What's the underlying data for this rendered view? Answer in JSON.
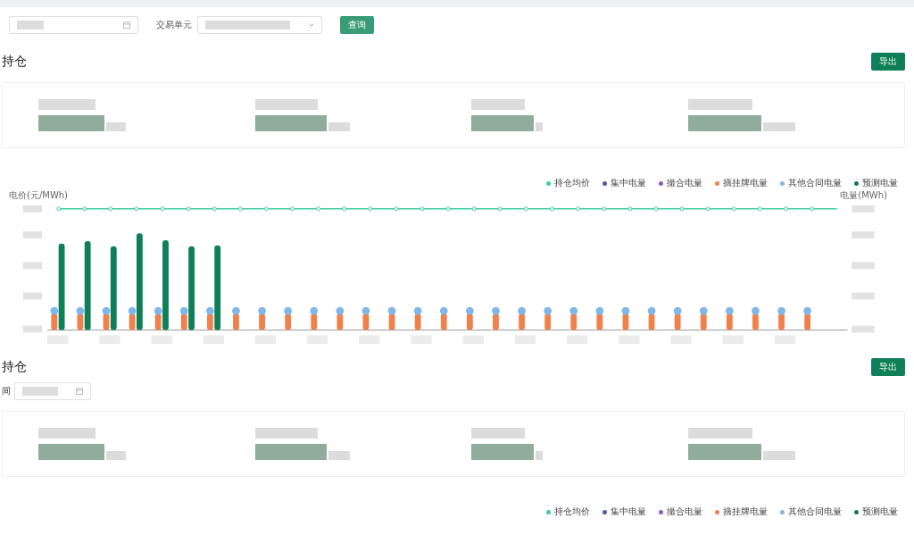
{
  "filters": {
    "trade_unit_label": "交易单元",
    "query_button": "查询"
  },
  "sections": [
    {
      "title": "持仓",
      "export_button": "导出",
      "chart": {
        "y_left_label": "电价(元/MWh)",
        "y_right_label": "电量(MWh)",
        "legend": [
          {
            "name": "持仓均价",
            "color": "#3fcf9f"
          },
          {
            "name": "集中电量",
            "color": "#4a5aa8"
          },
          {
            "name": "撮合电量",
            "color": "#8a5cc7"
          },
          {
            "name": "摘挂牌电量",
            "color": "#f0814a"
          },
          {
            "name": "其他合同电量",
            "color": "#7fb7e6"
          },
          {
            "name": "预测电量",
            "color": "#157a52"
          }
        ]
      }
    },
    {
      "title": "持仓",
      "export_button": "导出",
      "date_label": "间",
      "chart": {
        "legend": [
          {
            "name": "持仓均价",
            "color": "#3fcf9f"
          },
          {
            "name": "集中电量",
            "color": "#4a5aa8"
          },
          {
            "name": "撮合电量",
            "color": "#8a5cc7"
          },
          {
            "name": "摘挂牌电量",
            "color": "#f0814a"
          },
          {
            "name": "其他合同电量",
            "color": "#7fb7e6"
          },
          {
            "name": "预测电量",
            "color": "#157a52"
          }
        ]
      }
    }
  ]
}
